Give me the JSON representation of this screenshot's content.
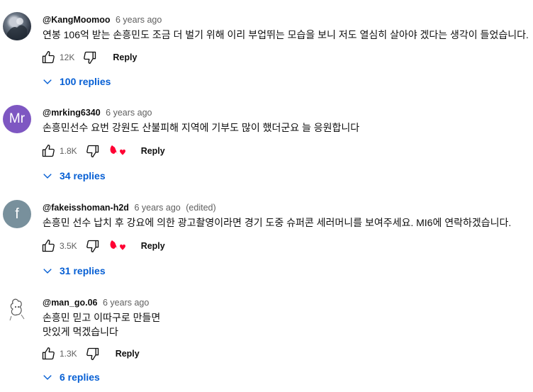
{
  "comments": [
    {
      "handle": "@KangMoomoo",
      "time": "6 years ago",
      "edited": "",
      "text": "연봉 106억 받는 손흥민도 조금 더 벌기 위해 이리 부업뛰는 모습을 보니 저도 열심히 살아야 겠다는 생각이 들었습니다.",
      "likes": "12K",
      "reply_label": "Reply",
      "replies_label": "100 replies",
      "avatar": "photo"
    },
    {
      "handle": "@mrking6340",
      "time": "6 years ago",
      "edited": "",
      "text": "손흥민선수 요번 강원도 산불피해 지역에 기부도 많이 했더군요 늘 응원합니다",
      "likes": "1.8K",
      "reply_label": "Reply",
      "replies_label": "34 replies",
      "avatar_initials": "Mr"
    },
    {
      "handle": "@fakeisshoman-h2d",
      "time": "6 years ago",
      "edited": "(edited)",
      "text": "손흥민 선수 납치 후 강요에 의한 광고촬영이라면 경기 도중 슈퍼콘 세러머니를 보여주세요. MI6에 연락하겠습니다.",
      "likes": "3.5K",
      "reply_label": "Reply",
      "replies_label": "31 replies",
      "avatar_initials": "f"
    },
    {
      "handle": "@man_go.06",
      "time": "6 years ago",
      "edited": "",
      "text": "손흥민 믿고 이따구로 만들면\n맛있게 먹겠습니다",
      "likes": "1.3K",
      "reply_label": "Reply",
      "replies_label": "6 replies",
      "avatar": "drawing"
    }
  ],
  "icons": {
    "like": "thumb-up-icon",
    "dislike": "thumb-down-icon",
    "creator_heart": "creator-heart-icon",
    "expand": "chevron-down-icon"
  },
  "colors": {
    "link_blue": "#065fd4",
    "heart_red": "#ff0033",
    "secondary_text": "#606060"
  }
}
